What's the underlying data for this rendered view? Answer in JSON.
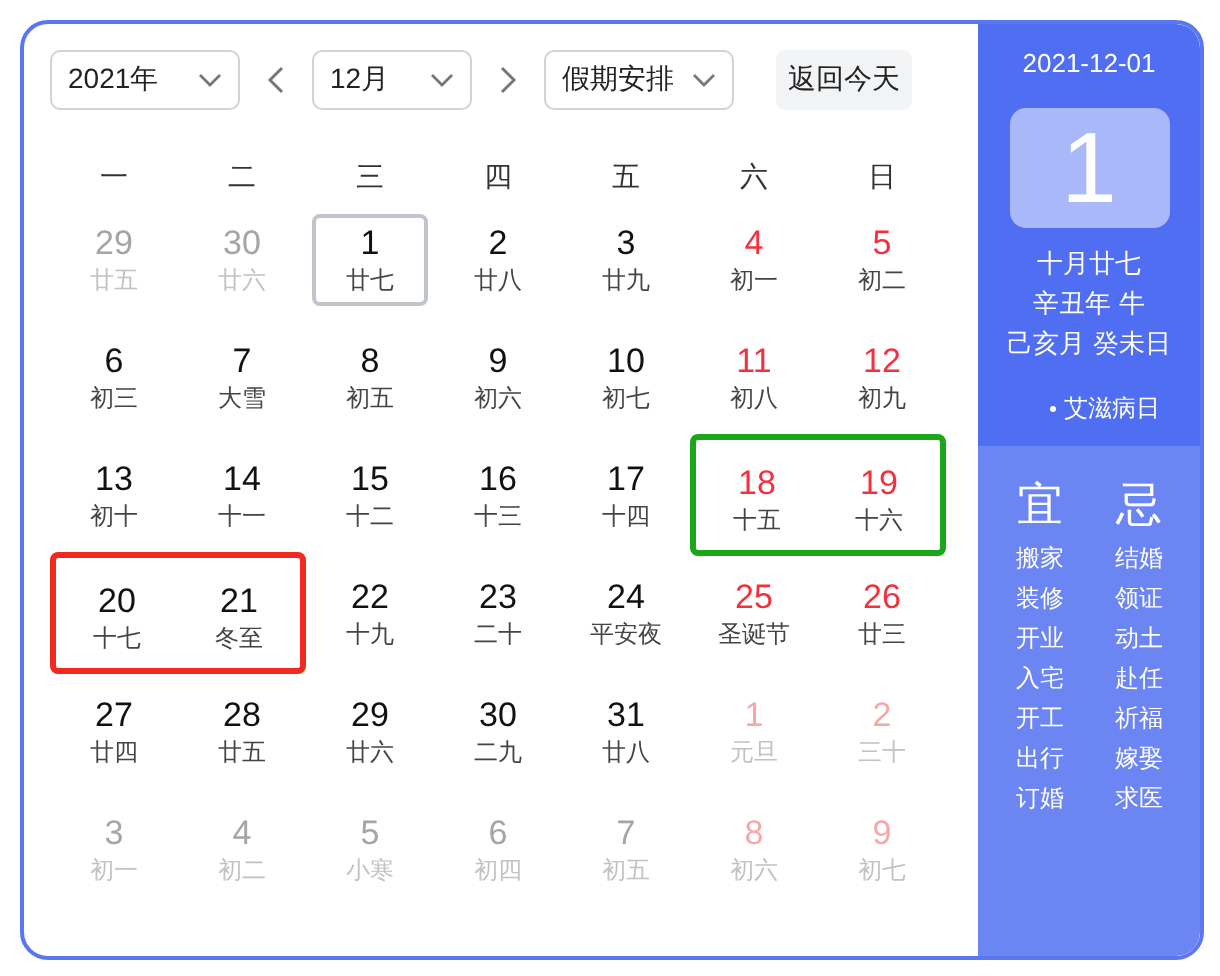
{
  "toolbar": {
    "year_select": {
      "value": "2021年"
    },
    "month_select": {
      "value": "12月"
    },
    "holiday_select": {
      "value": "假期安排"
    },
    "today_button": "返回今天"
  },
  "weekdays": [
    "一",
    "二",
    "三",
    "四",
    "五",
    "六",
    "日"
  ],
  "weeks": [
    [
      {
        "day": "29",
        "lunar": "廿五",
        "other_month": true,
        "weekend": false,
        "selected": false
      },
      {
        "day": "30",
        "lunar": "廿六",
        "other_month": true,
        "weekend": false,
        "selected": false
      },
      {
        "day": "1",
        "lunar": "廿七",
        "other_month": false,
        "weekend": false,
        "selected": true
      },
      {
        "day": "2",
        "lunar": "廿八",
        "other_month": false,
        "weekend": false,
        "selected": false
      },
      {
        "day": "3",
        "lunar": "廿九",
        "other_month": false,
        "weekend": false,
        "selected": false
      },
      {
        "day": "4",
        "lunar": "初一",
        "other_month": false,
        "weekend": true,
        "selected": false
      },
      {
        "day": "5",
        "lunar": "初二",
        "other_month": false,
        "weekend": true,
        "selected": false
      }
    ],
    [
      {
        "day": "6",
        "lunar": "初三",
        "other_month": false,
        "weekend": false,
        "selected": false
      },
      {
        "day": "7",
        "lunar": "大雪",
        "other_month": false,
        "weekend": false,
        "selected": false
      },
      {
        "day": "8",
        "lunar": "初五",
        "other_month": false,
        "weekend": false,
        "selected": false
      },
      {
        "day": "9",
        "lunar": "初六",
        "other_month": false,
        "weekend": false,
        "selected": false
      },
      {
        "day": "10",
        "lunar": "初七",
        "other_month": false,
        "weekend": false,
        "selected": false
      },
      {
        "day": "11",
        "lunar": "初八",
        "other_month": false,
        "weekend": true,
        "selected": false
      },
      {
        "day": "12",
        "lunar": "初九",
        "other_month": false,
        "weekend": true,
        "selected": false
      }
    ],
    [
      {
        "day": "13",
        "lunar": "初十",
        "other_month": false,
        "weekend": false,
        "selected": false
      },
      {
        "day": "14",
        "lunar": "十一",
        "other_month": false,
        "weekend": false,
        "selected": false
      },
      {
        "day": "15",
        "lunar": "十二",
        "other_month": false,
        "weekend": false,
        "selected": false
      },
      {
        "day": "16",
        "lunar": "十三",
        "other_month": false,
        "weekend": false,
        "selected": false
      },
      {
        "day": "17",
        "lunar": "十四",
        "other_month": false,
        "weekend": false,
        "selected": false
      },
      {
        "day": "18",
        "lunar": "十五",
        "other_month": false,
        "weekend": true,
        "selected": false,
        "color": "#1aa81a"
      },
      {
        "day": "19",
        "lunar": "十六",
        "other_month": false,
        "weekend": true,
        "selected": false,
        "color": "#1aa81a"
      }
    ],
    [
      {
        "day": "20",
        "lunar": "十七",
        "other_month": false,
        "weekend": false,
        "selected": false,
        "color": "#f22a1e"
      },
      {
        "day": "21",
        "lunar": "冬至",
        "other_month": false,
        "weekend": false,
        "selected": false,
        "color": "#f22a1e"
      },
      {
        "day": "22",
        "lunar": "十九",
        "other_month": false,
        "weekend": false,
        "selected": false
      },
      {
        "day": "23",
        "lunar": "二十",
        "other_month": false,
        "weekend": false,
        "selected": false
      },
      {
        "day": "24",
        "lunar": "平安夜",
        "other_month": false,
        "weekend": false,
        "selected": false
      },
      {
        "day": "25",
        "lunar": "圣诞节",
        "other_month": false,
        "weekend": true,
        "selected": false
      },
      {
        "day": "26",
        "lunar": "廿三",
        "other_month": false,
        "weekend": true,
        "selected": false
      }
    ],
    [
      {
        "day": "27",
        "lunar": "廿四",
        "other_month": false,
        "weekend": false,
        "selected": false
      },
      {
        "day": "28",
        "lunar": "廿五",
        "other_month": false,
        "weekend": false,
        "selected": false
      },
      {
        "day": "29",
        "lunar": "廿六",
        "other_month": false,
        "weekend": false,
        "selected": false
      },
      {
        "day": "30",
        "lunar": "二九",
        "other_month": false,
        "weekend": false,
        "selected": false
      },
      {
        "day": "31",
        "lunar": "廿八",
        "other_month": false,
        "weekend": false,
        "selected": false
      },
      {
        "day": "1",
        "lunar": "元旦",
        "other_month": true,
        "weekend": true,
        "selected": false
      },
      {
        "day": "2",
        "lunar": "三十",
        "other_month": true,
        "weekend": true,
        "selected": false
      }
    ],
    [
      {
        "day": "3",
        "lunar": "初一",
        "other_month": true,
        "weekend": false,
        "selected": false
      },
      {
        "day": "4",
        "lunar": "初二",
        "other_month": true,
        "weekend": false,
        "selected": false
      },
      {
        "day": "5",
        "lunar": "小寒",
        "other_month": true,
        "weekend": false,
        "selected": false
      },
      {
        "day": "6",
        "lunar": "初四",
        "other_month": true,
        "weekend": false,
        "selected": false
      },
      {
        "day": "7",
        "lunar": "初五",
        "other_month": true,
        "weekend": false,
        "selected": false
      },
      {
        "day": "8",
        "lunar": "初六",
        "other_month": true,
        "weekend": true,
        "selected": false
      },
      {
        "day": "9",
        "lunar": "初七",
        "other_month": true,
        "weekend": true,
        "selected": false
      }
    ]
  ],
  "detail": {
    "date": "2021-12-01",
    "day": "1",
    "lunar_date": "十月廿七",
    "year_ganzhi": "辛丑年 牛",
    "month_day_ganzhi": "己亥月 癸未日",
    "festivals": [
      "艾滋病日"
    ],
    "suitable": {
      "label": "宜",
      "items": [
        "搬家",
        "装修",
        "开业",
        "入宅",
        "开工",
        "出行",
        "订婚"
      ]
    },
    "avoid": {
      "label": "忌",
      "items": [
        "结婚",
        "领证",
        "动土",
        "赴任",
        "祈福",
        "嫁娶",
        "求医"
      ]
    }
  }
}
